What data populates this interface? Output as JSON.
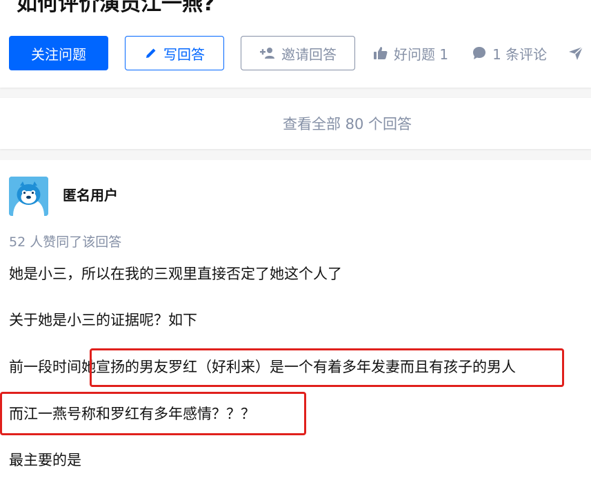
{
  "question": {
    "title": "如何评价演员江一燕?"
  },
  "actions": {
    "follow_label": "关注问题",
    "write_label": "写回答",
    "invite_label": "邀请回答",
    "good_question_label": "好问题 1",
    "comment_label": "1 条评论"
  },
  "all_answers_label": "查看全部 80 个回答",
  "answer": {
    "author": "匿名用户",
    "vote_text": "52 人赞同了该回答",
    "paragraphs": [
      "她是小三，所以在我的三观里直接否定了她这个人了",
      "关于她是小三的证据呢？如下",
      "前一段时间她宣扬的男友罗红（好利来）是一个有着多年发妻而且有孩子的男人",
      "而江一燕号称和罗红有多年感情？？？",
      "最主要的是"
    ]
  },
  "colors": {
    "primary": "#0066ff",
    "muted": "#8590a6",
    "highlight": "#e0201c"
  },
  "icons": [
    "pencil-icon",
    "add-user-icon",
    "thumbs-up-icon",
    "comment-icon",
    "share-icon"
  ]
}
